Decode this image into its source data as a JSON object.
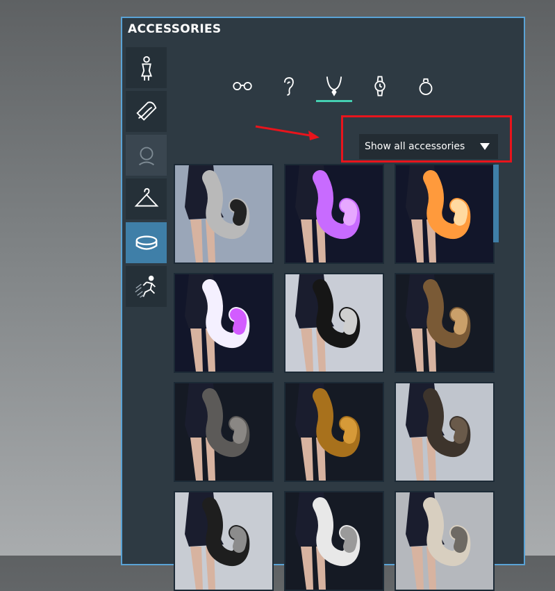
{
  "panel": {
    "title": "ACCESSORIES"
  },
  "sidebar": {
    "items": [
      {
        "name": "body",
        "icon": "body-icon"
      },
      {
        "name": "hair",
        "icon": "comb-icon"
      },
      {
        "name": "face",
        "icon": "head-outline-icon",
        "state": "disabled"
      },
      {
        "name": "clothing",
        "icon": "hanger-icon"
      },
      {
        "name": "accessories",
        "icon": "accessory-ring-icon",
        "state": "active"
      },
      {
        "name": "animations",
        "icon": "running-figure-icon"
      }
    ]
  },
  "categories": [
    {
      "name": "glasses",
      "icon": "glasses-icon"
    },
    {
      "name": "earrings",
      "icon": "ear-icon"
    },
    {
      "name": "necklaces",
      "icon": "necklace-icon",
      "selected": true
    },
    {
      "name": "watches",
      "icon": "watch-icon"
    },
    {
      "name": "rings",
      "icon": "ring-icon"
    }
  ],
  "filter": {
    "label": "Show all accessories"
  },
  "colors": {
    "accent": "#45d0b2",
    "highlight": "#e8141c",
    "panel_border": "#5aa3d6",
    "active": "#3f7fa8"
  },
  "items": [
    {
      "name": "grey-black-tail",
      "tail_color": "#b9b9b9",
      "tip_color": "#222222",
      "bg": "#9aa6b8"
    },
    {
      "name": "purple-glow-tail",
      "tail_color": "#c86bff",
      "tip_color": "#e6a8ff",
      "bg": "#12162a"
    },
    {
      "name": "orange-glow-tail",
      "tail_color": "#ff9a3c",
      "tip_color": "#ffd9a0",
      "bg": "#12162a"
    },
    {
      "name": "white-glow-tail",
      "tail_color": "#f4f0ff",
      "tip_color": "#d25cff",
      "bg": "#12162a"
    },
    {
      "name": "black-white-tail",
      "tail_color": "#161616",
      "tip_color": "#cfcfcf",
      "bg": "#c9cdd6"
    },
    {
      "name": "leopard-tail",
      "tail_color": "#7a5a36",
      "tip_color": "#caa06a",
      "bg": "#151a24"
    },
    {
      "name": "grey-fur-tail",
      "tail_color": "#5c5a58",
      "tip_color": "#8a8784",
      "bg": "#151a24"
    },
    {
      "name": "golden-fur-tail",
      "tail_color": "#a8711c",
      "tip_color": "#d69a38",
      "bg": "#151a24"
    },
    {
      "name": "brown-fur-tail",
      "tail_color": "#3d342c",
      "tip_color": "#6a5a4a",
      "bg": "#c0c5cd"
    },
    {
      "name": "dark-tail",
      "tail_color": "#1e1e1e",
      "tip_color": "#8c8c8c",
      "bg": "#c8ccd3"
    },
    {
      "name": "white-grey-tail",
      "tail_color": "#e8e8e8",
      "tip_color": "#9a9a9a",
      "bg": "#151a24"
    },
    {
      "name": "cream-tail",
      "tail_color": "#d8cfc0",
      "tip_color": "#6e6a64",
      "bg": "#b5b8bd"
    }
  ]
}
